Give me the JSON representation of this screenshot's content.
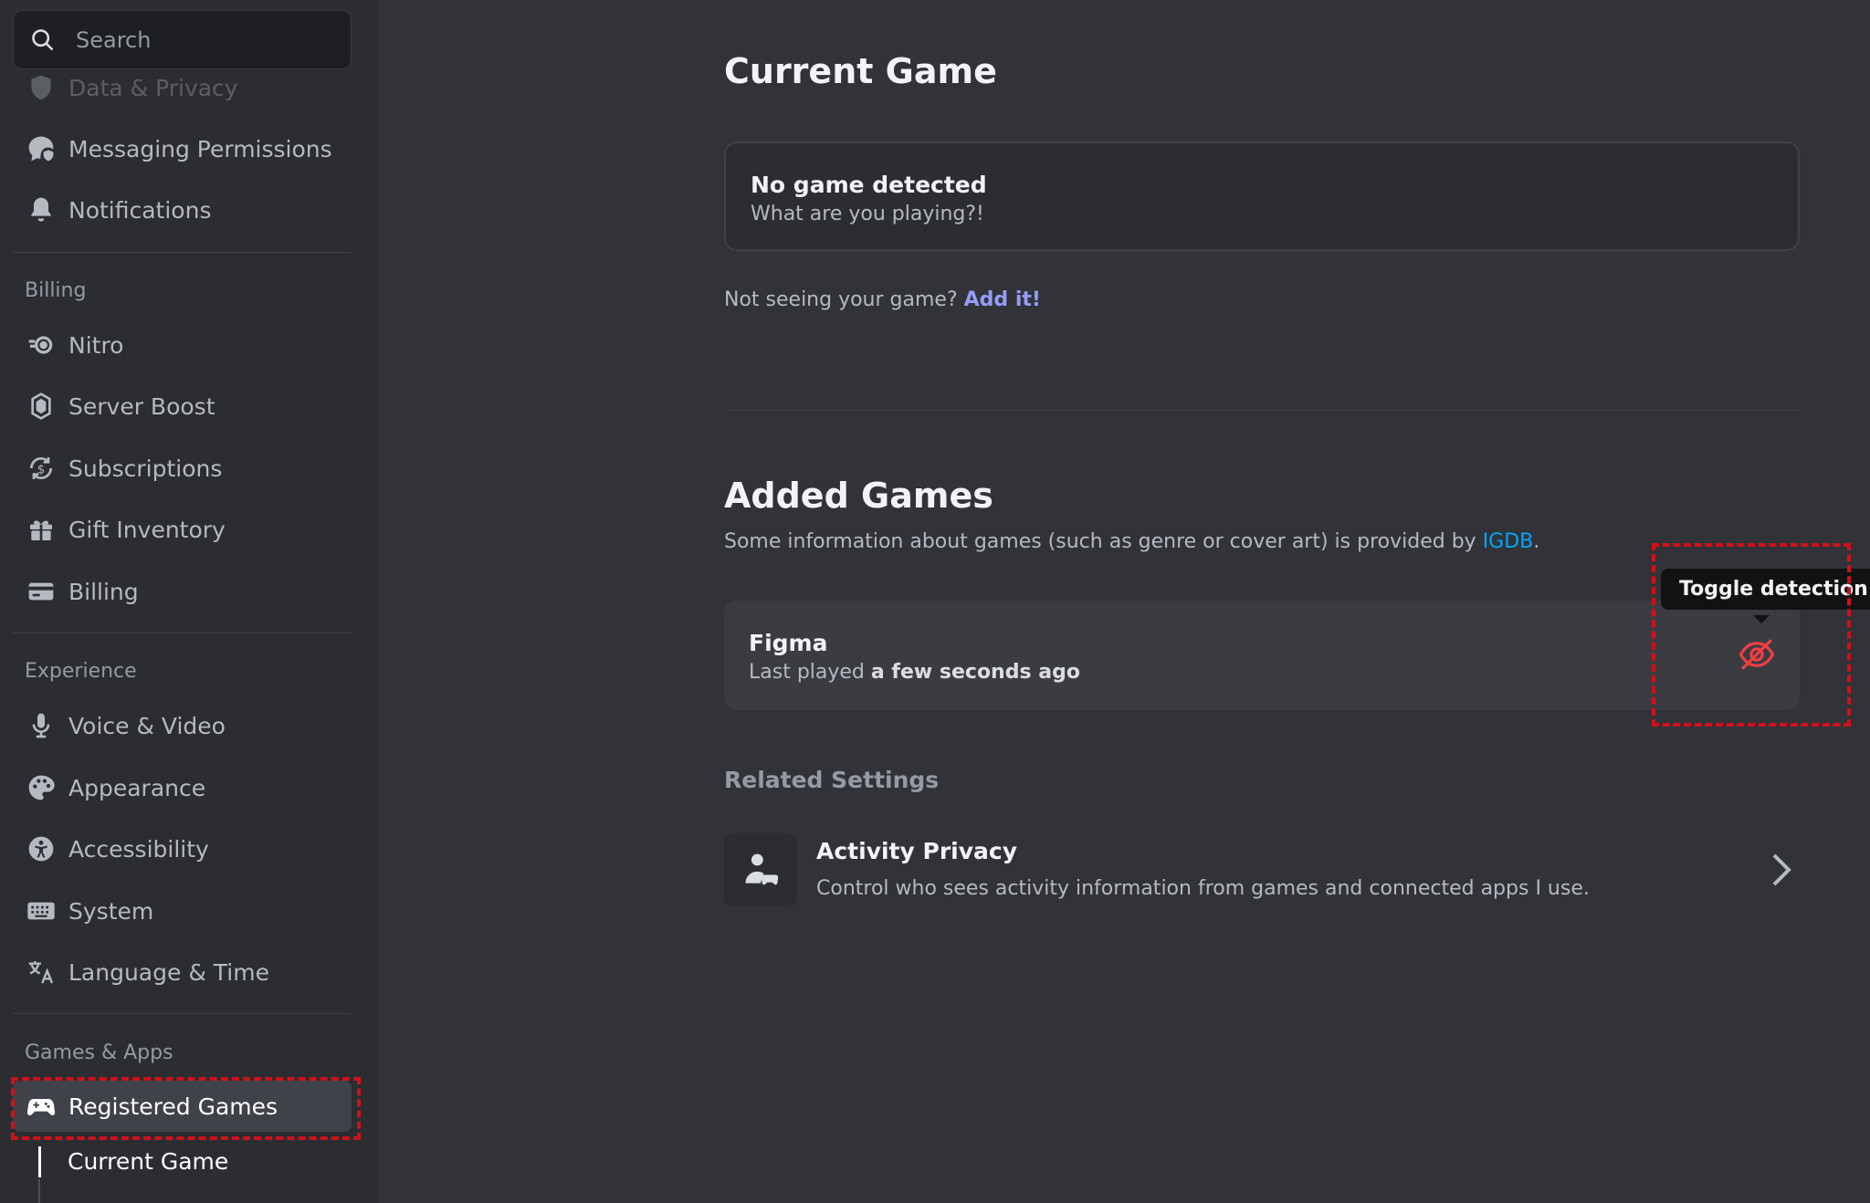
{
  "search": {
    "placeholder": "Search"
  },
  "sidebar": {
    "items_top": [
      {
        "label": "Data & Privacy",
        "icon": "shield-icon"
      },
      {
        "label": "Messaging Permissions",
        "icon": "message-shield-icon"
      },
      {
        "label": "Notifications",
        "icon": "bell-icon"
      }
    ],
    "billing_header": "Billing",
    "billing_items": [
      {
        "label": "Nitro",
        "icon": "nitro-icon"
      },
      {
        "label": "Server Boost",
        "icon": "boost-icon"
      },
      {
        "label": "Subscriptions",
        "icon": "subscription-icon"
      },
      {
        "label": "Gift Inventory",
        "icon": "gift-icon"
      },
      {
        "label": "Billing",
        "icon": "credit-card-icon"
      }
    ],
    "experience_header": "Experience",
    "experience_items": [
      {
        "label": "Voice & Video",
        "icon": "microphone-icon"
      },
      {
        "label": "Appearance",
        "icon": "palette-icon"
      },
      {
        "label": "Accessibility",
        "icon": "accessibility-icon"
      },
      {
        "label": "System",
        "icon": "keyboard-icon"
      },
      {
        "label": "Language & Time",
        "icon": "translate-icon"
      }
    ],
    "games_header": "Games & Apps",
    "games_items": [
      {
        "label": "Registered Games",
        "icon": "gamepad-icon",
        "selected": true
      }
    ],
    "sub_items": [
      {
        "label": "Current Game"
      }
    ]
  },
  "main": {
    "current_game": {
      "title": "Current Game",
      "card_title": "No game detected",
      "card_sub": "What are you playing?!",
      "not_seeing": "Not seeing your game?",
      "add_link": "Add it!"
    },
    "added_games": {
      "title": "Added Games",
      "info_prefix": "Some information about games (such as genre or cover art) is provided by",
      "info_link": "IGDB",
      "info_suffix": ".",
      "game": {
        "name": "Figma",
        "last_played_prefix": "Last played",
        "last_played_value": "a few seconds ago"
      },
      "tooltip": "Toggle detection"
    },
    "related": {
      "title": "Related Settings",
      "item_title": "Activity Privacy",
      "item_desc": "Control who sees activity information from games and connected apps I use."
    }
  },
  "colors": {
    "background": "#313338",
    "sidebar": "#2b2d31",
    "accent_link": "#949cf7",
    "igdb_link": "#00a8fc",
    "danger": "#f23f43",
    "highlight": "#d0101a"
  }
}
